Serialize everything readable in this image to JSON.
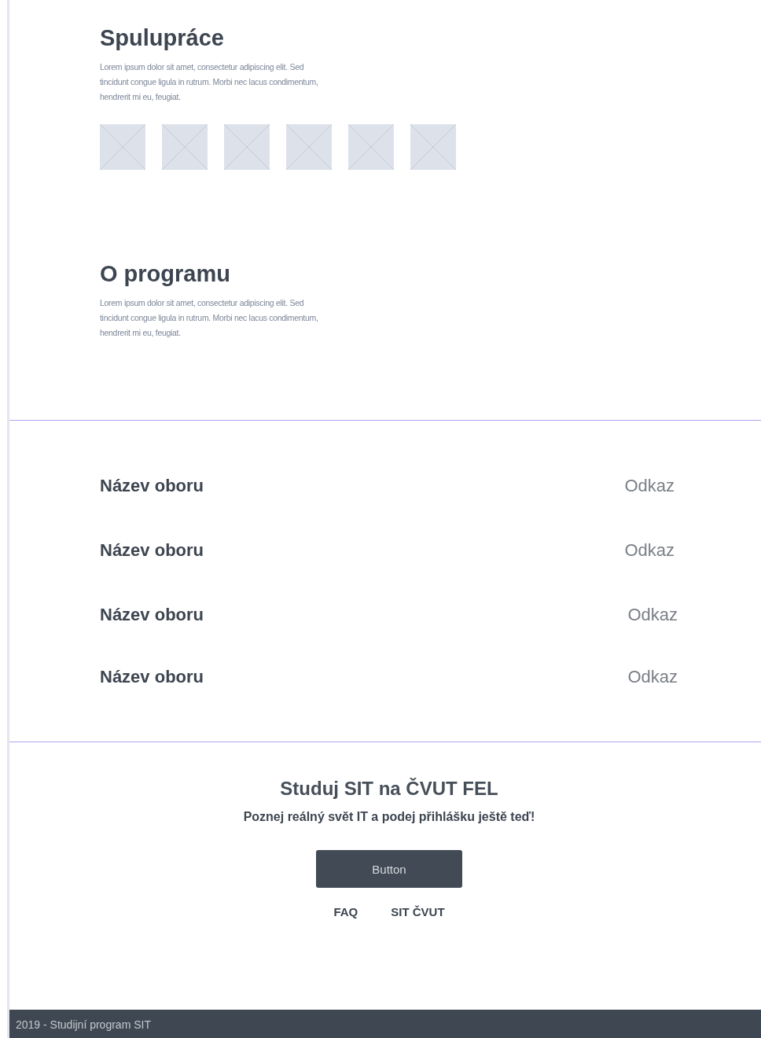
{
  "sections": [
    {
      "title": "Spulupráce",
      "text": "Lorem ipsum dolor sit amet, consectetur adipiscing elit. Sed tincidunt congue ligula in rutrum. Morbi nec lacus condimentum, hendrerit mi eu, feugiat.",
      "logos": [
        {
          "kind": "placeholder"
        },
        {
          "kind": "placeholder"
        },
        {
          "kind": "placeholder"
        },
        {
          "kind": "placeholder"
        },
        {
          "kind": "placeholder"
        },
        {
          "kind": "placeholder"
        }
      ]
    },
    {
      "title": "O programu",
      "text": "Lorem ipsum dolor sit amet, consectetur adipiscing elit. Sed tincidunt congue ligula in rutrum. Morbi nec lacus condimentum, hendrerit mi eu, feugiat."
    }
  ],
  "fields": [
    {
      "name": "Název oboru",
      "link": "Odkaz"
    },
    {
      "name": "Název oboru",
      "link": "Odkaz"
    },
    {
      "name": "Název oboru",
      "link": "Odkaz"
    },
    {
      "name": "Název oboru",
      "link": "Odkaz"
    }
  ],
  "cta": {
    "title": "Studuj SIT na ČVUT FEL",
    "subtitle": "Poznej reálný svět IT a podej přihlášku ještě teď!",
    "button": "Button",
    "links": [
      "FAQ",
      "SIT ČVUT"
    ]
  },
  "footer": "2019 - Studijní program SIT"
}
